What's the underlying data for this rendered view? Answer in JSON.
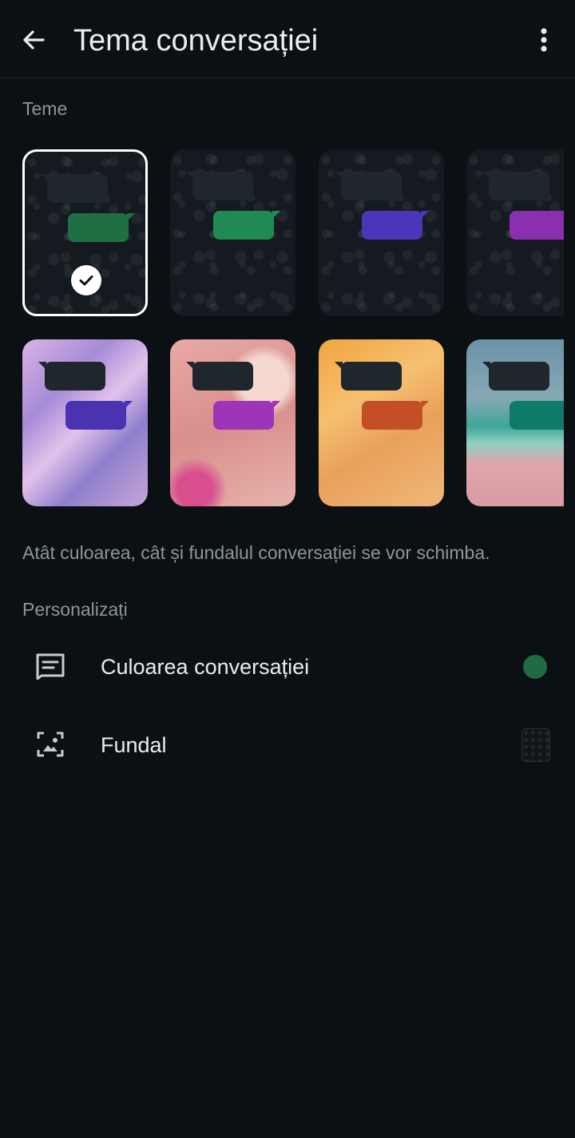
{
  "header": {
    "title": "Tema conversației",
    "back_icon": "arrow-left-icon",
    "more_icon": "more-vert-icon"
  },
  "themes_section": {
    "label": "Teme",
    "selected_index": 0,
    "tiles": [
      {
        "kind": "dark",
        "bubble_color": "#1f6f45"
      },
      {
        "kind": "dark",
        "bubble_color": "#1f8a54"
      },
      {
        "kind": "dark",
        "bubble_color": "#4b35b8"
      },
      {
        "kind": "dark",
        "bubble_color": "#8a2fb0"
      },
      {
        "kind": "image",
        "bubble_color": "#4a33b0",
        "wallpaper": "iridescent"
      },
      {
        "kind": "image",
        "bubble_color": "#9e35b8",
        "wallpaper": "pink-flowers"
      },
      {
        "kind": "image",
        "bubble_color": "#c44e25",
        "wallpaper": "orange-silk"
      },
      {
        "kind": "image",
        "bubble_color": "#0d7a6a",
        "wallpaper": "beach"
      }
    ]
  },
  "note": "Atât culoarea, cât și fundalul conversației se vor schimba.",
  "customize_section": {
    "label": "Personalizați",
    "items": [
      {
        "label": "Culoarea conversației",
        "icon": "chat-color-icon",
        "value_color": "#1e6b44"
      },
      {
        "label": "Fundal",
        "icon": "wallpaper-icon"
      }
    ]
  },
  "colors": {
    "background": "#0b1014",
    "text_primary": "#e9edef",
    "text_secondary": "#8d969b"
  }
}
